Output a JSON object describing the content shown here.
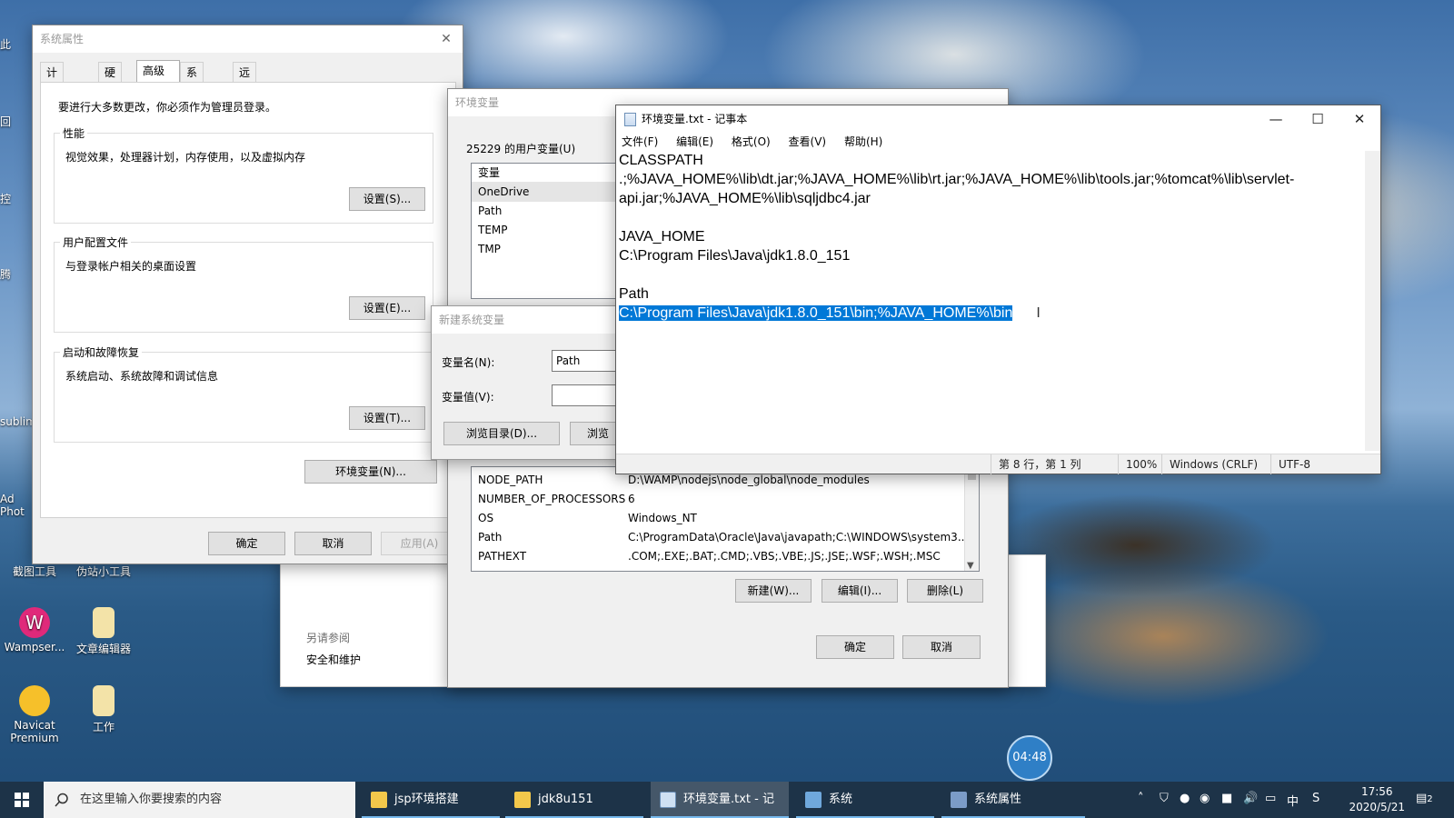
{
  "desktop": {
    "icons": [
      {
        "label": "截图工具",
        "icon": "scissors-icon"
      },
      {
        "label": "伪站小工具",
        "icon": "tool-icon"
      },
      {
        "label": "Wampser...",
        "icon": "wampserver-icon"
      },
      {
        "label": "文章编辑器",
        "icon": "document-icon"
      },
      {
        "label": "Navicat Premium",
        "icon": "navicat-icon"
      },
      {
        "label": "工作",
        "icon": "folder-icon"
      }
    ],
    "edge_labels": [
      "此",
      "回",
      "控",
      "腾",
      "sublim",
      "Ad Phot"
    ]
  },
  "system_properties": {
    "title": "系统属性",
    "tabs": [
      "计算机名",
      "硬件",
      "高级",
      "系统保护",
      "远程"
    ],
    "active_tab": "高级",
    "admin_note": "要进行大多数更改，你必须作为管理员登录。",
    "performance": {
      "label": "性能",
      "desc": "视觉效果，处理器计划，内存使用，以及虚拟内存",
      "button": "设置(S)..."
    },
    "profiles": {
      "label": "用户配置文件",
      "desc": "与登录帐户相关的桌面设置",
      "button": "设置(E)..."
    },
    "startup": {
      "label": "启动和故障恢复",
      "desc": "系统启动、系统故障和调试信息",
      "button": "设置(T)..."
    },
    "env_button": "环境变量(N)...",
    "ok": "确定",
    "cancel": "取消",
    "apply": "应用(A)"
  },
  "env_dialog": {
    "title": "环境变量",
    "user_vars_label": "25229 的用户变量(U)",
    "user_vars_header": "变量",
    "user_vars": [
      "OneDrive",
      "Path",
      "TEMP",
      "TMP"
    ],
    "system_vars": [
      {
        "name": "NODE_PATH",
        "value": "D:\\WAMP\\nodejs\\node_global\\node_modules"
      },
      {
        "name": "NUMBER_OF_PROCESSORS",
        "value": "6"
      },
      {
        "name": "OS",
        "value": "Windows_NT"
      },
      {
        "name": "Path",
        "value": "C:\\ProgramData\\Oracle\\Java\\javapath;C:\\WINDOWS\\system3..."
      },
      {
        "name": "PATHEXT",
        "value": ".COM;.EXE;.BAT;.CMD;.VBS;.VBE;.JS;.JSE;.WSF;.WSH;.MSC"
      }
    ],
    "new_button": "新建(W)...",
    "edit_button": "编辑(I)...",
    "delete_button": "删除(L)",
    "ok": "确定",
    "cancel": "取消"
  },
  "control_panel": {
    "see_also": "另请参阅",
    "security": "安全和维护"
  },
  "new_var_dialog": {
    "title": "新建系统变量",
    "name_label": "变量名(N):",
    "name_value": "Path",
    "value_label": "变量值(V):",
    "value_value": "",
    "browse_dir": "浏览目录(D)...",
    "browse_file": "浏览"
  },
  "notepad": {
    "title": "环境变量.txt - 记事本",
    "menu": [
      "文件(F)",
      "编辑(E)",
      "格式(O)",
      "查看(V)",
      "帮助(H)"
    ],
    "lines": [
      "CLASSPATH",
      ".;%JAVA_HOME%\\lib\\dt.jar;%JAVA_HOME%\\lib\\rt.jar;%JAVA_HOME%\\lib\\tools.jar;%tomcat%\\lib\\servlet-",
      "api.jar;%JAVA_HOME%\\lib\\sqljdbc4.jar",
      "",
      "JAVA_HOME",
      "C:\\Program Files\\Java\\jdk1.8.0_151",
      "",
      "Path"
    ],
    "selected_line": "C:\\Program Files\\Java\\jdk1.8.0_151\\bin;%JAVA_HOME%\\bin",
    "status": {
      "position": "第 8 行，第 1 列",
      "zoom": "100%",
      "line_ending": "Windows (CRLF)",
      "encoding": "UTF-8"
    }
  },
  "recorder": {
    "timer": "04:48"
  },
  "taskbar": {
    "search_placeholder": "在这里输入你要搜索的内容",
    "items": [
      {
        "label": "jsp环境搭建",
        "icon": "folder-icon",
        "active": false
      },
      {
        "label": "jdk8u151",
        "icon": "folder-icon",
        "active": false
      },
      {
        "label": "环境变量.txt - 记事...",
        "icon": "notepad-icon",
        "active": true
      },
      {
        "label": "系统",
        "icon": "system-icon",
        "active": false
      },
      {
        "label": "系统属性",
        "icon": "system-properties-icon",
        "active": false
      }
    ],
    "time": "17:56",
    "date": "2020/5/21",
    "notification_count": "2",
    "accent": "#76b9ed"
  }
}
